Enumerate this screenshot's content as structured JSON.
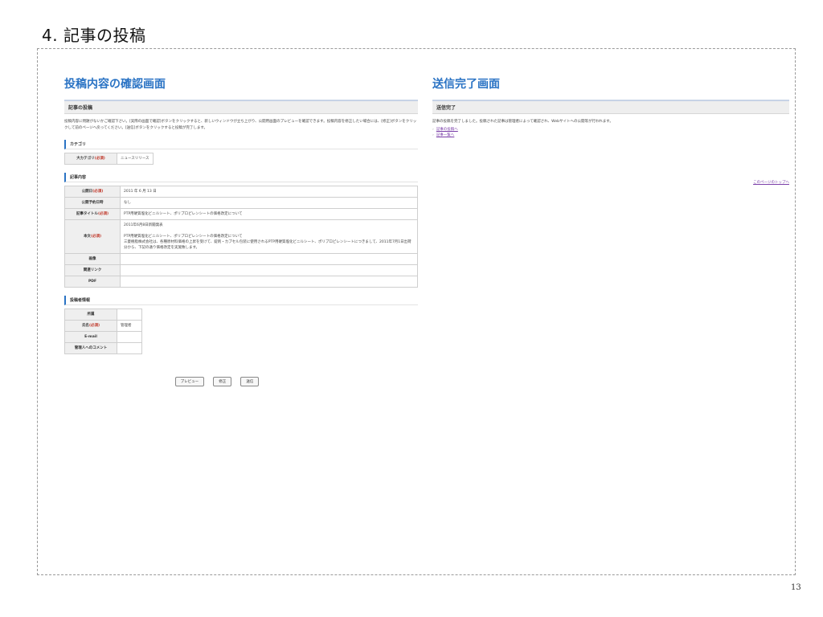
{
  "slide": {
    "title": "4. 記事の投稿",
    "page_number": "13"
  },
  "confirm": {
    "title": "投稿内容の確認画面",
    "box_header": "記事の投稿",
    "description": "投稿内容に問題がないかご確認下さい。[実際の画面で確認]ボタンをクリックすると、新しいウィンドウが立ち上がり、公開用画面のプレビューを確認できます。投稿内容を修正したい場合には、[修正]ボタンをクリックして前のページへ戻ってください。[送信]ボタンをクリックすると投稿が完了します。",
    "required_mark": "(必須)",
    "category": {
      "heading": "カテゴリ",
      "label": "大カテゴリ",
      "value": "ニュースリリース"
    },
    "article": {
      "heading": "記事内容",
      "publish_date_label": "公開日",
      "publish_date_value": "2011 年 6 月 13 日",
      "schedule_label": "公開予約日時",
      "schedule_value": "なし",
      "title_label": "記事タイトル",
      "title_value": "PTP用硬質塩化ビニルシート、ポリプロピレンシートの価格改定について",
      "body_label": "本文",
      "body_line1": "2011年6月8日新聞発表",
      "body_line2": "PTP用硬質塩化ビニルシート、ポリプロピレンシートの価格改定について",
      "body_line3": "三菱樹脂株式会社は、各種原材料価格の上昇を受けて、錠剤・カプセル包装に使用されるPTP用硬質塩化ビニルシート、ポリプロピレンシートにつきまして、2011年7月1日出荷分から、下記の通り価格改定を実施致します。",
      "image_label": "画像",
      "image_value": "",
      "link_label": "関連リンク",
      "link_value": "",
      "pdf_label": "PDF",
      "pdf_value": ""
    },
    "poster": {
      "heading": "投稿者情報",
      "affiliation_label": "所属",
      "affiliation_value": "",
      "name_label": "氏名",
      "name_value": "管理者",
      "email_label": "E-mail",
      "email_value": "",
      "comment_label": "管理人へのコメント",
      "comment_value": ""
    },
    "buttons": {
      "preview": "プレビュー",
      "edit": "修正",
      "submit": "送信"
    }
  },
  "complete": {
    "title": "送信完了画面",
    "box_header": "送信完了",
    "description": "記事の投稿を完了しました。投稿された記事は管理者によって確認され、Webサイトへの公開等が行われます。",
    "links": [
      "記事の投稿へ",
      "記事一覧へ"
    ],
    "to_top": "このページのトップへ"
  }
}
